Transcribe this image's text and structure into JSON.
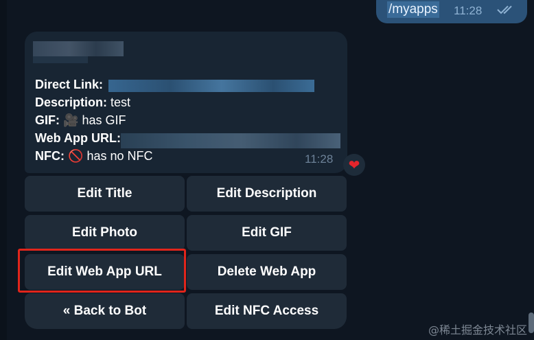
{
  "outgoing": {
    "text": "/myapps",
    "time": "11:28"
  },
  "incoming": {
    "lines": [
      {
        "label": "Direct Link:",
        "value": ""
      },
      {
        "label": "Description:",
        "value": "test"
      },
      {
        "label": "GIF:",
        "emoji": "🎥",
        "value": "has GIF"
      },
      {
        "label": "Web App URL:",
        "value": ""
      },
      {
        "label": "NFC:",
        "emoji": "🚫",
        "value": "has no NFC"
      }
    ],
    "time": "11:28",
    "reaction": "❤"
  },
  "keyboard": {
    "buttons": [
      "Edit Title",
      "Edit Description",
      "Edit Photo",
      "Edit GIF",
      "Edit Web App URL",
      "Delete Web App",
      "« Back to Bot",
      "Edit NFC Access"
    ]
  },
  "colors": {
    "background": "#0e1621",
    "bubble_out": "#2b5278",
    "bubble_in": "#182533",
    "button": "#1f2b38",
    "highlight": "#e1251b"
  },
  "watermark": "@稀土掘金技术社区"
}
